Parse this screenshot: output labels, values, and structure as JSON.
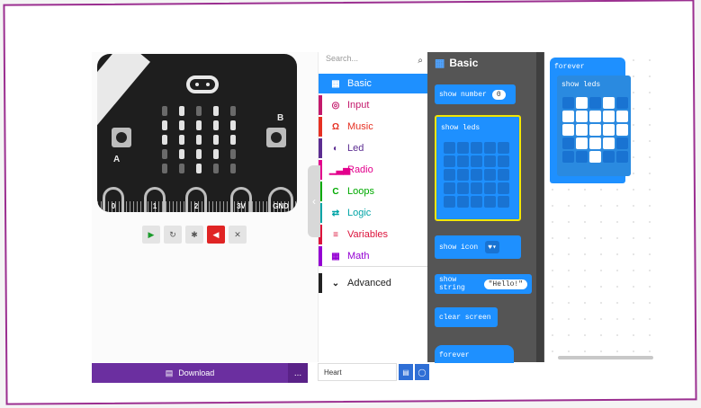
{
  "simulator": {
    "pin_labels": [
      "0",
      "1",
      "2",
      "3V",
      "GND"
    ],
    "button_a": "A",
    "button_b": "B",
    "controls": [
      "play-icon",
      "restart-icon",
      "debug-icon",
      "mute-icon",
      "fullscreen-icon"
    ],
    "led_matrix": [
      [
        0,
        1,
        0,
        1,
        0
      ],
      [
        1,
        1,
        1,
        1,
        1
      ],
      [
        1,
        1,
        1,
        1,
        1
      ],
      [
        0,
        1,
        1,
        1,
        0
      ],
      [
        0,
        0,
        1,
        0,
        0
      ]
    ]
  },
  "toolbox": {
    "search_placeholder": "Search...",
    "categories": [
      {
        "label": "Basic",
        "icon": "grid-icon",
        "color": "#1e90ff"
      },
      {
        "label": "Input",
        "icon": "target-icon",
        "color": "#c3196b"
      },
      {
        "label": "Music",
        "icon": "headphones-icon",
        "color": "#e63022"
      },
      {
        "label": "Led",
        "icon": "toggle-icon",
        "color": "#5c2d91"
      },
      {
        "label": "Radio",
        "icon": "signal-icon",
        "color": "#e3008c"
      },
      {
        "label": "Loops",
        "icon": "loop-icon",
        "color": "#00aa00"
      },
      {
        "label": "Logic",
        "icon": "shuffle-icon",
        "color": "#00a4a6"
      },
      {
        "label": "Variables",
        "icon": "lines-icon",
        "color": "#dc143c"
      },
      {
        "label": "Math",
        "icon": "calculator-icon",
        "color": "#9400d3"
      }
    ],
    "advanced_label": "Advanced"
  },
  "flyout": {
    "title": "Basic",
    "show_number": "show number",
    "show_number_value": "0",
    "show_leds": "show leds",
    "show_icon": "show icon",
    "show_string": "show string",
    "show_string_value": "\"Hello!\"",
    "clear_screen": "clear screen",
    "forever": "forever"
  },
  "workspace": {
    "forever_label": "forever",
    "show_leds_label": "show leds",
    "led_matrix": [
      [
        0,
        1,
        0,
        1,
        0
      ],
      [
        1,
        1,
        1,
        1,
        1
      ],
      [
        1,
        1,
        1,
        1,
        1
      ],
      [
        0,
        1,
        1,
        1,
        0
      ],
      [
        0,
        0,
        1,
        0,
        0
      ]
    ]
  },
  "bottom": {
    "download_label": "Download",
    "more_label": "...",
    "project_name": "Heart"
  },
  "colors": {
    "accent": "#1e90ff",
    "download": "#6b2fa0",
    "flyout_bg": "#555555",
    "frame": "#9b2f90"
  }
}
